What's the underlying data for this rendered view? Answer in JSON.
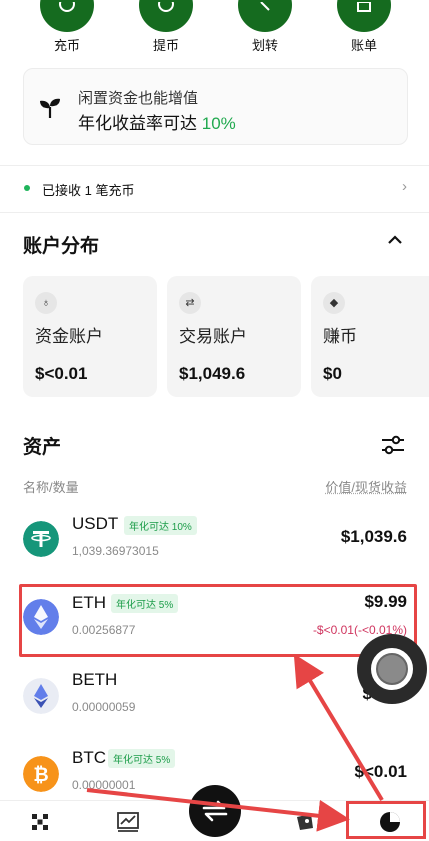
{
  "quick_actions": [
    {
      "label": "充币",
      "icon": "deposit-icon"
    },
    {
      "label": "提币",
      "icon": "withdraw-icon"
    },
    {
      "label": "划转",
      "icon": "transfer-icon"
    },
    {
      "label": "账单",
      "icon": "bill-icon"
    }
  ],
  "promo": {
    "line1": "闲置资金也能增值",
    "line2_prefix": "年化收益率可达",
    "line2_rate": "10%"
  },
  "deposit_notice": {
    "text": "已接收 1 笔充币"
  },
  "account_distribution": {
    "title": "账户分布",
    "accounts": [
      {
        "name": "资金账户",
        "value": "$<0.01",
        "icon": "fund-account-icon"
      },
      {
        "name": "交易账户",
        "value": "$1,049.6",
        "icon": "trading-account-icon"
      },
      {
        "name": "赚币",
        "value": "$0",
        "icon": "earn-icon"
      }
    ]
  },
  "assets": {
    "title": "资产",
    "col_left": "名称/数量",
    "col_right": "价值/现货收益",
    "items": [
      {
        "symbol": "USDT",
        "badge": "年化可达 10%",
        "qty": "1,039.36973015",
        "value": "$1,039.6",
        "pnl": "",
        "color": "#16967a"
      },
      {
        "symbol": "ETH",
        "badge": "年化可达 5%",
        "qty": "0.00256877",
        "value": "$9.99",
        "pnl": "-$<0.01(-<0.01%)",
        "color": "#627eea"
      },
      {
        "symbol": "BETH",
        "badge": "",
        "qty": "0.00000059",
        "value": "$",
        "pnl": "",
        "color": "#627eea"
      },
      {
        "symbol": "BTC",
        "badge": "年化可达 5%",
        "qty": "0.00000001",
        "value": "$<0.01",
        "pnl": "",
        "color": "#f7931a"
      }
    ]
  },
  "tabbar": {
    "items": [
      "home-icon",
      "market-icon",
      "trade-icon",
      "earn-tab-icon",
      "assets-icon"
    ]
  },
  "colors": {
    "brand_green": "#156b1f",
    "highlight_red": "#e64545",
    "positive_green": "#21a94f",
    "negative_red": "#d0355f"
  }
}
